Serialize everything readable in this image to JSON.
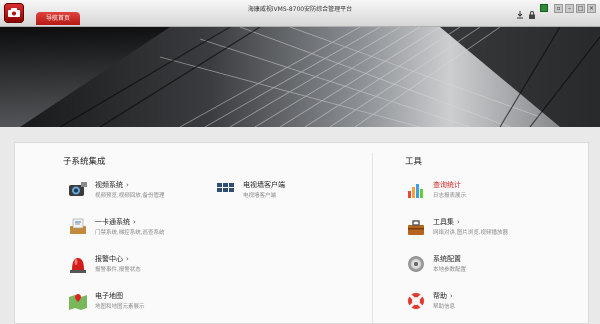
{
  "title": "海康威视iVMS-8700安防综合管理平台",
  "tab": "导航首页",
  "subsystems": {
    "heading": "子系统集成",
    "items": [
      {
        "name": "视频系统",
        "desc": "视频预览,视频回放,备份管理",
        "arrow": "›"
      },
      {
        "name": "电视墙客户端",
        "desc": "电视墙客户端",
        "arrow": ""
      },
      {
        "name": "一卡通系统",
        "desc": "门禁系统,梯控系统,巡查系统",
        "arrow": "›"
      },
      {
        "name": "报警中心",
        "desc": "报警事件,报警状态",
        "arrow": "›"
      },
      {
        "name": "电子地图",
        "desc": "地图和地图元素展示",
        "arrow": ""
      }
    ]
  },
  "tools": {
    "heading": "工具",
    "items": [
      {
        "name": "查询统计",
        "desc": "日志报表展示",
        "arrow": ""
      },
      {
        "name": "工具集",
        "desc": "网络对讲,图片浏览,视频播放器",
        "arrow": "›"
      },
      {
        "name": "系统配置",
        "desc": "本地参数配置",
        "arrow": ""
      },
      {
        "name": "帮助",
        "desc": "帮助信息",
        "arrow": "›"
      }
    ]
  }
}
